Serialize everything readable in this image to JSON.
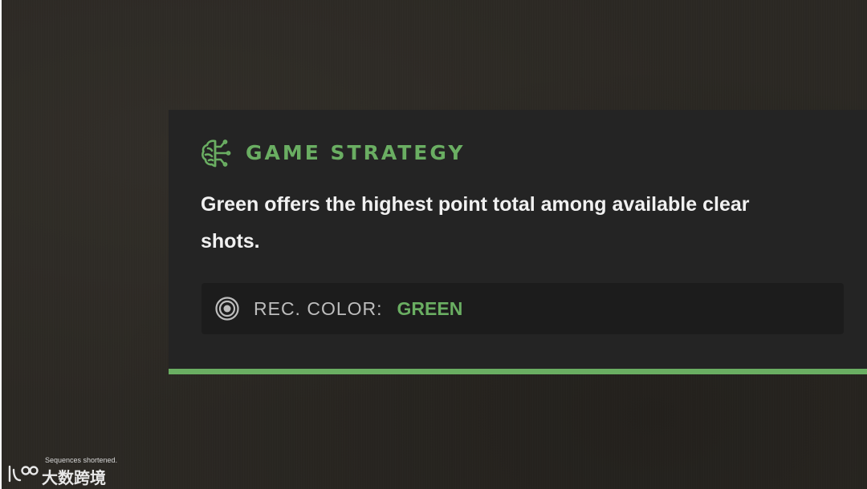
{
  "strategy_card": {
    "icon": "brain-icon",
    "title": "GAME STRATEGY",
    "body": "Green offers the highest point total among available clear shots.",
    "recommendation": {
      "icon": "target-icon",
      "label": "REC. COLOR:",
      "value": "GREEN"
    }
  },
  "watermark": {
    "note": "Sequences shortened.",
    "brand": "大数跨境"
  },
  "colors": {
    "accent_green": "#6aae62",
    "card_background": "#242424",
    "rec_box_background": "#1c1c1c",
    "page_background": "#2b2823"
  }
}
